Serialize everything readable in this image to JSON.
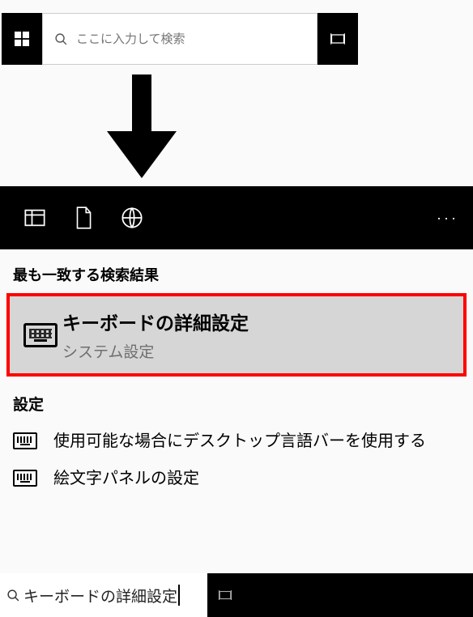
{
  "topbar": {
    "placeholder": "ここに入力して検索"
  },
  "sections": {
    "best": "最も一致する検索結果",
    "settings": "設定"
  },
  "highlighted": {
    "title": "キーボードの詳細設定",
    "subtitle": "システム設定"
  },
  "items": [
    "使用可能な場合にデスクトップ言語バーを使用する",
    "絵文字パネルの設定"
  ],
  "query": "キーボードの詳細設定",
  "more": "···"
}
